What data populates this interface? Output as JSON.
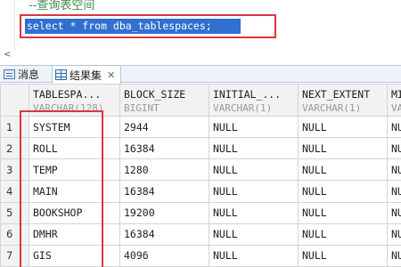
{
  "editor": {
    "comment": "--查询表空间",
    "sql": "select * from dba_tablespaces;",
    "scroll_arrow": "<"
  },
  "tabs": [
    {
      "label": "消息",
      "icon": "message-icon"
    },
    {
      "label": "结果集",
      "icon": "grid-icon",
      "active": true,
      "close": "✕"
    }
  ],
  "grid": {
    "columns": [
      {
        "name": "TABLESPA...",
        "type": "VARCHAR(128)"
      },
      {
        "name": "BLOCK_SIZE",
        "type": "BIGINT"
      },
      {
        "name": "INITIAL_...",
        "type": "VARCHAR(1)"
      },
      {
        "name": "NEXT_EXTENT",
        "type": "VARCHAR(1)"
      },
      {
        "name": "MI",
        "type": "VA"
      }
    ],
    "rows": [
      {
        "num": "1",
        "cells": [
          "SYSTEM",
          "2944",
          "NULL",
          "NULL",
          "NU"
        ]
      },
      {
        "num": "2",
        "cells": [
          "ROLL",
          "16384",
          "NULL",
          "NULL",
          "NU"
        ]
      },
      {
        "num": "3",
        "cells": [
          "TEMP",
          "1280",
          "NULL",
          "NULL",
          "NU"
        ]
      },
      {
        "num": "4",
        "cells": [
          "MAIN",
          "16384",
          "NULL",
          "NULL",
          "NU"
        ]
      },
      {
        "num": "5",
        "cells": [
          "BOOKSHOP",
          "19200",
          "NULL",
          "NULL",
          "NU"
        ]
      },
      {
        "num": "6",
        "cells": [
          "DMHR",
          "16384",
          "NULL",
          "NULL",
          "NU"
        ]
      },
      {
        "num": "7",
        "cells": [
          "GIS",
          "4096",
          "NULL",
          "NULL",
          "NU"
        ]
      }
    ]
  },
  "colors": {
    "highlight_box": "#d9363e",
    "selection": "#3070d0",
    "comment": "#3f8a4e"
  }
}
